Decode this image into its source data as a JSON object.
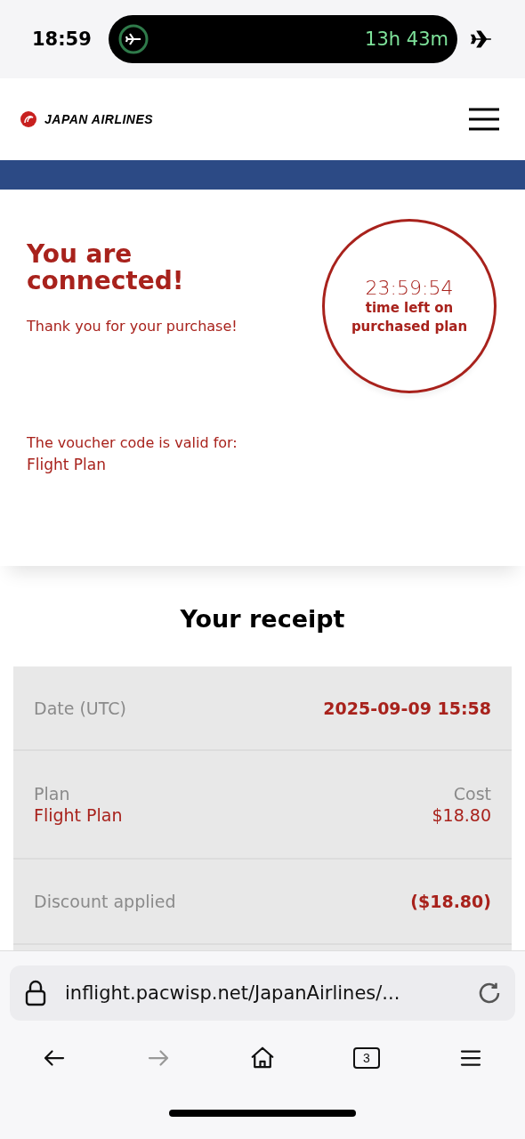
{
  "status_bar": {
    "time": "18:59",
    "activity": "13h 43m"
  },
  "header": {
    "brand": "JAPAN AIRLINES"
  },
  "connection": {
    "title": "You are connected!",
    "message": "Thank you for your purchase!",
    "timer": "23:59:54",
    "timer_label": "time left on purchased plan",
    "voucher_label": "The voucher code is valid for:",
    "voucher_plan": "Flight Plan"
  },
  "receipt": {
    "title": "Your receipt",
    "rows": [
      {
        "kind": "single",
        "label": "Date (UTC)",
        "value": "2025-09-09 15:58"
      },
      {
        "kind": "double",
        "label": "Plan",
        "label_value": "Flight Plan",
        "right_label": "Cost",
        "right_value": "$18.80"
      },
      {
        "kind": "single",
        "label": "Discount applied",
        "value": "($18.80)"
      }
    ]
  },
  "browser": {
    "url": "inflight.pacwisp.net/JapanAirlines/...",
    "tab_count": "3",
    "nav": [
      {
        "kind": "back",
        "disabled": false
      },
      {
        "kind": "forward",
        "disabled": true
      },
      {
        "kind": "home",
        "disabled": false
      },
      {
        "kind": "tabs",
        "disabled": false
      },
      {
        "kind": "menu",
        "disabled": false
      }
    ]
  }
}
